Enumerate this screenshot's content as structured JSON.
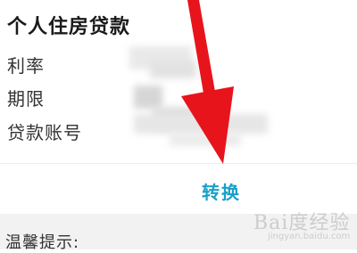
{
  "card": {
    "title": "个人住房贷款",
    "rows": [
      {
        "label": "利率"
      },
      {
        "label": "期限"
      },
      {
        "label": "贷款账号"
      }
    ]
  },
  "actions": {
    "convert_label": "转换"
  },
  "tips": {
    "title": "温馨提示:"
  },
  "watermark": {
    "main": "Bai度经验",
    "sub": "jingyan.baidu.com"
  },
  "colors": {
    "accent": "#1aa0c8",
    "annotation_arrow": "#e8141c",
    "tips_background": "#f2f2f2"
  }
}
